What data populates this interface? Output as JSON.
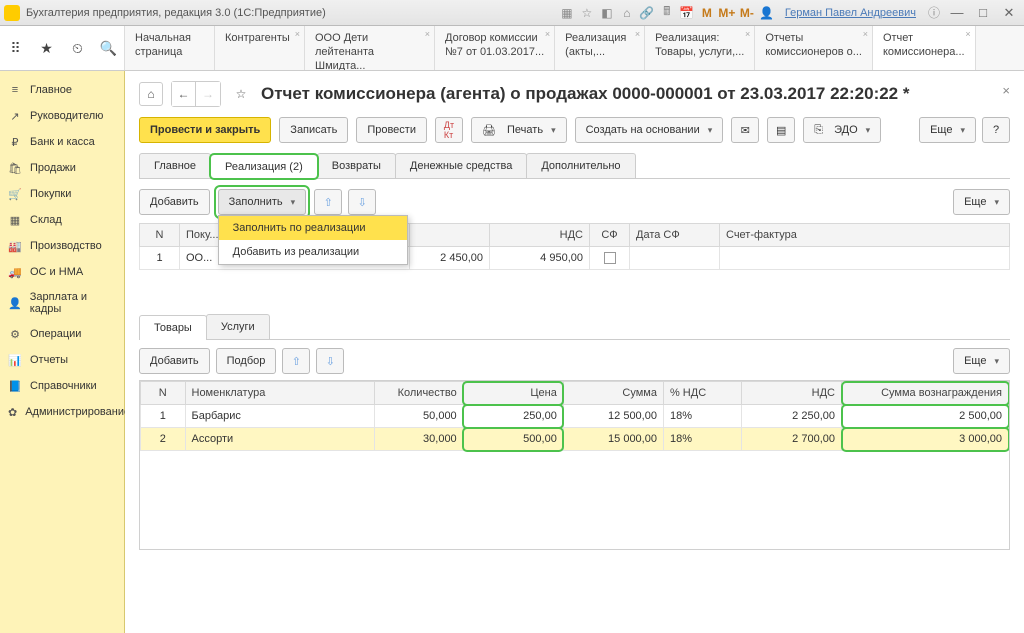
{
  "titlebar": {
    "title": "Бухгалтерия предприятия, редакция 3.0 (1С:Предприятие)",
    "user": "Герман Павел Андреевич",
    "m_labels": [
      "M",
      "M+",
      "M-"
    ]
  },
  "nav_tabs": [
    {
      "l1": "Начальная",
      "l2": "страница"
    },
    {
      "l1": "Контрагенты",
      "l2": ""
    },
    {
      "l1": "ООО Дети",
      "l2": "лейтенанта Шмидта..."
    },
    {
      "l1": "Договор комиссии",
      "l2": "№7 от 01.03.2017..."
    },
    {
      "l1": "Реализация",
      "l2": "(акты,..."
    },
    {
      "l1": "Реализация:",
      "l2": "Товары, услуги,..."
    },
    {
      "l1": "Отчеты",
      "l2": "комиссионеров о..."
    },
    {
      "l1": "Отчет",
      "l2": "комиссионера..."
    }
  ],
  "sidebar": [
    {
      "icon": "≡",
      "label": "Главное"
    },
    {
      "icon": "↗",
      "label": "Руководителю"
    },
    {
      "icon": "₽",
      "label": "Банк и касса"
    },
    {
      "icon": "🛍",
      "label": "Продажи"
    },
    {
      "icon": "🛒",
      "label": "Покупки"
    },
    {
      "icon": "▦",
      "label": "Склад"
    },
    {
      "icon": "🏭",
      "label": "Производство"
    },
    {
      "icon": "🚚",
      "label": "ОС и НМА"
    },
    {
      "icon": "👤",
      "label": "Зарплата и кадры"
    },
    {
      "icon": "⚙",
      "label": "Операции"
    },
    {
      "icon": "📊",
      "label": "Отчеты"
    },
    {
      "icon": "📘",
      "label": "Справочники"
    },
    {
      "icon": "✿",
      "label": "Администрирование"
    }
  ],
  "header": {
    "title": "Отчет комиссионера (агента) о продажах 0000-000001 от 23.03.2017 22:20:22 *"
  },
  "toolbar": {
    "post_close": "Провести и закрыть",
    "write": "Записать",
    "post": "Провести",
    "print": "Печать",
    "create_based": "Создать на основании",
    "edo": "ЭДО",
    "more": "Еще"
  },
  "doc_tabs": [
    "Главное",
    "Реализация (2)",
    "Возвраты",
    "Денежные средства",
    "Дополнительно"
  ],
  "upper": {
    "add": "Добавить",
    "fill": "Заполнить",
    "more": "Еще",
    "fill_menu": [
      "Заполнить по реализации",
      "Добавить из реализации"
    ],
    "headers": {
      "n": "N",
      "buyer": "Поку...",
      "vat": "НДС",
      "sf": "СФ",
      "sf_date": "Дата СФ",
      "invoice": "Счет-фактура"
    },
    "row": {
      "n": "1",
      "buyer": "ОО...",
      "sum": "2 450,00",
      "vat": "4 950,00"
    }
  },
  "goods_tabs": [
    "Товары",
    "Услуги"
  ],
  "goods_toolbar": {
    "add": "Добавить",
    "pick": "Подбор",
    "more": "Еще"
  },
  "goods_headers": {
    "n": "N",
    "nomen": "Номенклатура",
    "qty": "Количество",
    "price": "Цена",
    "sum": "Сумма",
    "vat_pct": "% НДС",
    "vat": "НДС",
    "reward": "Сумма вознаграждения"
  },
  "goods_rows": [
    {
      "n": "1",
      "nomen": "Барбарис",
      "qty": "50,000",
      "price": "250,00",
      "sum": "12 500,00",
      "vat_pct": "18%",
      "vat": "2 250,00",
      "reward": "2 500,00"
    },
    {
      "n": "2",
      "nomen": "Ассорти",
      "qty": "30,000",
      "price": "500,00",
      "sum": "15 000,00",
      "vat_pct": "18%",
      "vat": "2 700,00",
      "reward": "3 000,00"
    }
  ]
}
